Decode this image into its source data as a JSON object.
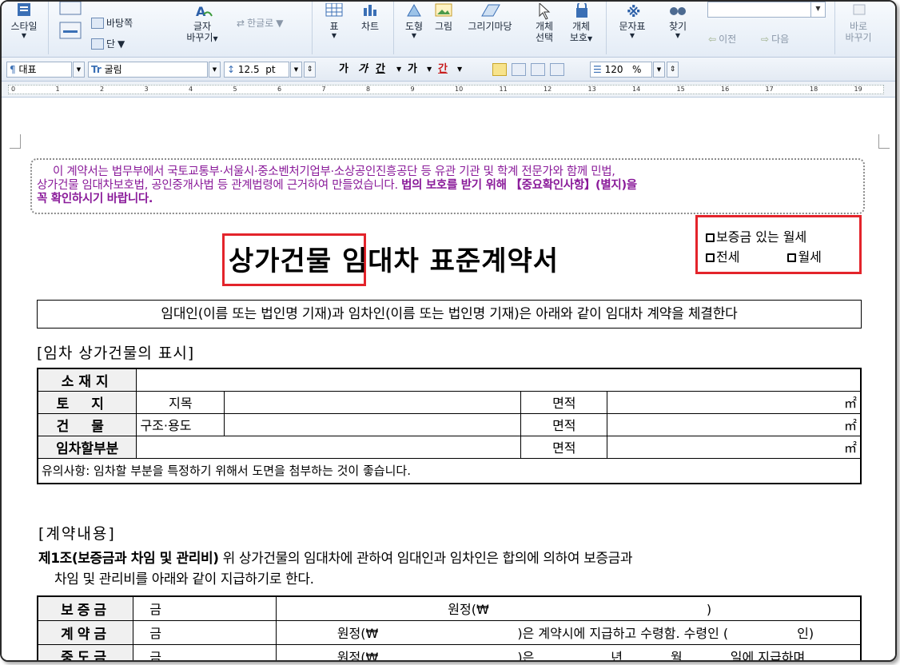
{
  "ribbon": {
    "style_label": "스타일",
    "master_page_label": "바탕쪽",
    "columns_label": "단",
    "char_change_label_1": "글자",
    "char_change_label_2": "바꾸기",
    "hanja_label": "한글로",
    "table_label": "표",
    "chart_label": "차트",
    "shape_label": "도형",
    "picture_label": "그림",
    "drawing_label": "그리기마당",
    "object_select_1": "개체",
    "object_select_2": "선택",
    "object_protect_1": "개체",
    "object_protect_2": "보호",
    "char_table_label": "문자표",
    "find_label": "찾기",
    "prev_label": "이전",
    "next_label": "다음",
    "quick_change_1": "바로",
    "quick_change_2": "바꾸기"
  },
  "format_bar": {
    "style_value": "대표",
    "font_value": "굴림",
    "size_value": "12.5",
    "size_unit": "pt",
    "bold": "가",
    "italic": "가",
    "underline": "간",
    "strike": "가",
    "color": "간",
    "line_spacing_value": "120",
    "line_spacing_unit": "%"
  },
  "ruler": {
    "ticks": [
      "0",
      "1",
      "2",
      "3",
      "4",
      "5",
      "6",
      "7",
      "8",
      "9",
      "10",
      "11",
      "12",
      "13",
      "14",
      "15",
      "16",
      "17",
      "18",
      "19"
    ]
  },
  "document": {
    "notice_line1": "이 계약서는 법무부에서 국토교통부·서울시·중소벤처기업부·소상공인진흥공단 등 유관 기관 및 학계 전문가와 함께 민법,",
    "notice_line2_a": "상가건물 임대차보호법, 공인중개사법 등 관계법령에 근거하여 만들었습니다. ",
    "notice_line2_b": "법의 보호를 받기 위해 【중요확인사항】(별지)을",
    "notice_line3": "꼭 확인하시기 바랍니다.",
    "title_part1": "상가건물",
    "title_part2": "임대차 표준계약서",
    "type_option1": "보증금 있는 월세",
    "type_option2": "전세",
    "type_option3": "월세",
    "intro": "임대인(이름 또는 법인명 기재)과 임차인(이름 또는 법인명 기재)은 아래와 같이 임대차 계약을 체결한다",
    "section1": "[임차 상가건물의 표시]",
    "property_table": {
      "location": "소재지",
      "land": "토지",
      "land_type": "지목",
      "building": "건물",
      "structure_use": "구조·용도",
      "leased_part": "임차할부분",
      "area": "면적",
      "unit": "㎡",
      "note": "유의사항: 임차할 부분을 특정하기 위해서 도면을 첨부하는 것이 좋습니다."
    },
    "section2": "[계약내용]",
    "article1_title": "제1조(보증금과 차임 및 관리비)",
    "article1_text": " 위 상가건물의 임대차에 관하여 임대인과 임차인은 합의에 의하여 보증금과",
    "article1_text2": "차임 및 관리비를 아래와 같이 지급하기로 한다.",
    "payment_table": {
      "deposit": "보증금",
      "down_payment": "계약금",
      "middle_payment": "중도금",
      "won_prefix": "금",
      "won_suffix": "원정(₩",
      "close_paren": ")",
      "down_clause": ")은 계약시에 지급하고 수령함. 수령인 (",
      "seal": "인)",
      "middle_clause": ")은",
      "year": "년",
      "month": "월",
      "middle_end": "일에 지급하며"
    }
  }
}
